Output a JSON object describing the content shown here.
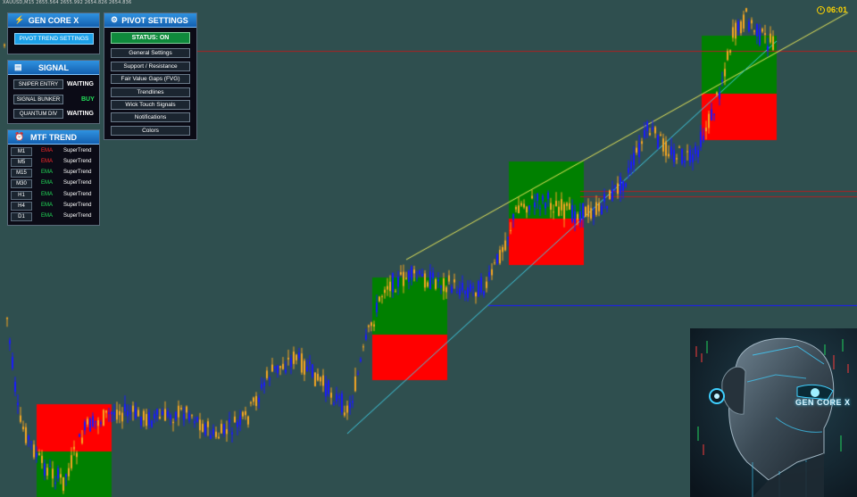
{
  "symbol_header": "XAUUSD,M15  2655.564 2655.992 2654.826 2654.836",
  "clock": {
    "time": "06:01",
    "icon": "clock-icon"
  },
  "core_panel": {
    "title": "GEN CORE X",
    "icon": "lightning-icon",
    "button": "PIVOT TREND SETTINGS"
  },
  "pivot_panel": {
    "title": "PIVOT SETTINGS",
    "icon": "gear-icon",
    "status": "STATUS: ON",
    "items": [
      "General Settings",
      "Support / Resistance",
      "Fair Value Gaps (FVG)",
      "Trendlines",
      "Wick Touch Signals",
      "Notifications",
      "Colors"
    ]
  },
  "signal_panel": {
    "title": "SIGNAL",
    "icon": "chart-icon",
    "rows": [
      {
        "label": "SNIPER ENTRY",
        "value": "WAITING",
        "color": "#ffffff"
      },
      {
        "label": "SIGNAL BUNKER",
        "value": "BUY",
        "color": "#22e05a"
      },
      {
        "label": "QUANTUM DIV",
        "value": "WAITING",
        "color": "#ffffff"
      }
    ]
  },
  "mtf_panel": {
    "title": "MTF TREND",
    "icon": "alarm-clock-icon",
    "rows": [
      {
        "tf": "M1",
        "ema": "EMA",
        "ema_color": "#ff2a2a",
        "st": "SuperTrend"
      },
      {
        "tf": "M5",
        "ema": "EMA",
        "ema_color": "#ff2a2a",
        "st": "SuperTrend"
      },
      {
        "tf": "M15",
        "ema": "EMA",
        "ema_color": "#22e05a",
        "st": "SuperTrend"
      },
      {
        "tf": "M30",
        "ema": "EMA",
        "ema_color": "#22e05a",
        "st": "SuperTrend"
      },
      {
        "tf": "H1",
        "ema": "EMA",
        "ema_color": "#22e05a",
        "st": "SuperTrend"
      },
      {
        "tf": "H4",
        "ema": "EMA",
        "ema_color": "#22e05a",
        "st": "SuperTrend"
      },
      {
        "tf": "D1",
        "ema": "EMA",
        "ema_color": "#22e05a",
        "st": "SuperTrend"
      }
    ]
  },
  "branding": {
    "text": "GEN CORE X"
  },
  "colors": {
    "background": "#2f4f4f",
    "bull_candle": "#1a1aff",
    "bear_candle": "#f5a623",
    "supply_zone": "#ff0000",
    "demand_zone": "#008000",
    "trendline_upper": "#e8e85a",
    "trendline_lower": "#40d0e8",
    "support_line": "#1a1aff",
    "resistance_line": "#b02020"
  }
}
